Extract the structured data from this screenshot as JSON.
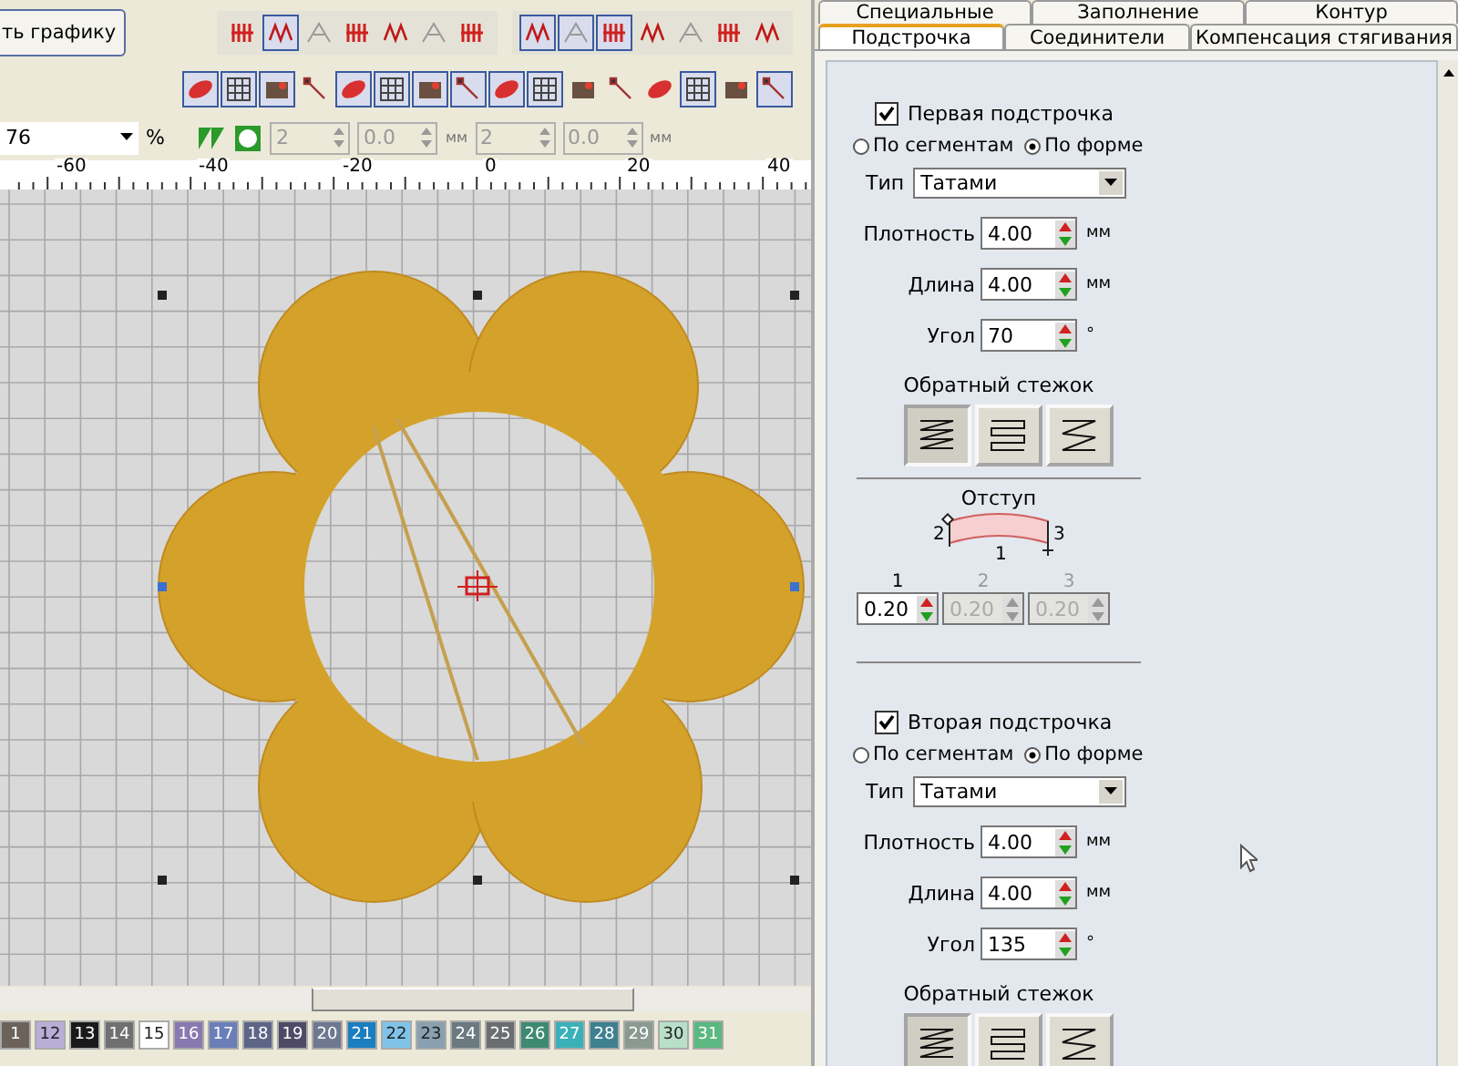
{
  "toolbar": {
    "button": "ть графику",
    "groups": [
      {
        "tools": [
          {
            "selected": false
          },
          {
            "selected": true
          },
          {
            "selected": false
          },
          {
            "selected": false
          },
          {
            "selected": false
          },
          {
            "selected": false
          },
          {
            "selected": false
          }
        ]
      },
      {
        "tools": [
          {
            "selected": true
          },
          {
            "selected": true
          },
          {
            "selected": true
          },
          {
            "selected": false
          },
          {
            "selected": false
          },
          {
            "selected": false
          },
          {
            "selected": false
          }
        ]
      }
    ],
    "row2_tools": [
      {
        "selected": true
      },
      {
        "selected": true
      },
      {
        "selected": true
      },
      {
        "selected": false
      },
      {
        "selected": true
      },
      {
        "selected": true
      },
      {
        "selected": true
      },
      {
        "selected": true
      },
      {
        "selected": true
      },
      {
        "selected": true
      },
      {
        "selected": false
      },
      {
        "selected": false
      },
      {
        "selected": false
      },
      {
        "selected": true
      },
      {
        "selected": false
      },
      {
        "selected": true
      }
    ],
    "zoom": {
      "value": "76",
      "unit": "%"
    },
    "spin_fields": [
      {
        "value": "2",
        "disabled": true
      },
      {
        "value": "0.0",
        "unit": "мм",
        "disabled": true
      },
      {
        "value": "2",
        "disabled": true
      },
      {
        "value": "0.0",
        "unit": "мм",
        "disabled": true
      }
    ]
  },
  "ruler": {
    "labels": [
      "-60",
      "-40",
      "-20",
      "0",
      "20",
      "40"
    ]
  },
  "palette": [
    {
      "label": "1",
      "color": "#6b625a"
    },
    {
      "label": "12",
      "color": "#b8aed8"
    },
    {
      "label": "13",
      "color": "#1a1a1a"
    },
    {
      "label": "14",
      "color": "#707070"
    },
    {
      "label": "15",
      "color": "#ffffff"
    },
    {
      "label": "16",
      "color": "#8a78b0"
    },
    {
      "label": "17",
      "color": "#6a7fb8"
    },
    {
      "label": "18",
      "color": "#5c6585"
    },
    {
      "label": "19",
      "color": "#4e4a66"
    },
    {
      "label": "20",
      "color": "#6e7890"
    },
    {
      "label": "21",
      "color": "#1a7ec0"
    },
    {
      "label": "22",
      "color": "#7fc4e8"
    },
    {
      "label": "23",
      "color": "#8aa0b0"
    },
    {
      "label": "24",
      "color": "#6a7a80"
    },
    {
      "label": "25",
      "color": "#6a6e70"
    },
    {
      "label": "26",
      "color": "#3e8a70"
    },
    {
      "label": "27",
      "color": "#3ab0b8"
    },
    {
      "label": "28",
      "color": "#3e8090"
    },
    {
      "label": "29",
      "color": "#8a9a90"
    },
    {
      "label": "30",
      "color": "#b8e0c8"
    },
    {
      "label": "31",
      "color": "#5ab880"
    }
  ],
  "panel": {
    "tabs_row1": [
      {
        "label": "Специальные",
        "selected": false
      },
      {
        "label": "Заполнение",
        "selected": false
      },
      {
        "label": "Контур",
        "selected": false
      }
    ],
    "tabs_row2": [
      {
        "label": "Подстрочка",
        "selected": true
      },
      {
        "label": "Соединители",
        "selected": false
      },
      {
        "label": "Компенсация стягивания",
        "selected": false
      }
    ],
    "sections": [
      {
        "checkbox": {
          "label": "Первая подстрочка",
          "checked": true
        },
        "radios": [
          {
            "label": "По сегментам",
            "selected": false
          },
          {
            "label": "По форме",
            "selected": true
          }
        ],
        "type_label": "Тип",
        "type_value": "Татами",
        "fields": [
          {
            "label": "Плотность",
            "value": "4.00",
            "unit": "мм"
          },
          {
            "label": "Длина",
            "value": "4.00",
            "unit": "мм"
          },
          {
            "label": "Угол",
            "value": "70",
            "unit": "°"
          }
        ],
        "reverse_label": "Обратный стежок",
        "reverse_buttons": [
          {
            "selected": true
          },
          {
            "selected": false
          },
          {
            "selected": false
          }
        ],
        "offset": {
          "label": "Отступ",
          "diagram_labels": [
            "2",
            "1",
            "3"
          ],
          "fields": [
            {
              "label": "1",
              "value": "0.20",
              "disabled": false
            },
            {
              "label": "2",
              "value": "0.20",
              "disabled": true
            },
            {
              "label": "3",
              "value": "0.20",
              "disabled": true
            }
          ]
        }
      },
      {
        "checkbox": {
          "label": "Вторая подстрочка",
          "checked": true
        },
        "radios": [
          {
            "label": "По сегментам",
            "selected": false
          },
          {
            "label": "По форме",
            "selected": true
          }
        ],
        "type_label": "Тип",
        "type_value": "Татами",
        "fields": [
          {
            "label": "Плотность",
            "value": "4.00",
            "unit": "мм"
          },
          {
            "label": "Длина",
            "value": "4.00",
            "unit": "мм"
          },
          {
            "label": "Угол",
            "value": "135",
            "unit": "°"
          }
        ],
        "reverse_label": "Обратный стежок",
        "reverse_buttons": [
          {
            "selected": true
          },
          {
            "selected": false
          },
          {
            "selected": false
          }
        ]
      }
    ]
  }
}
